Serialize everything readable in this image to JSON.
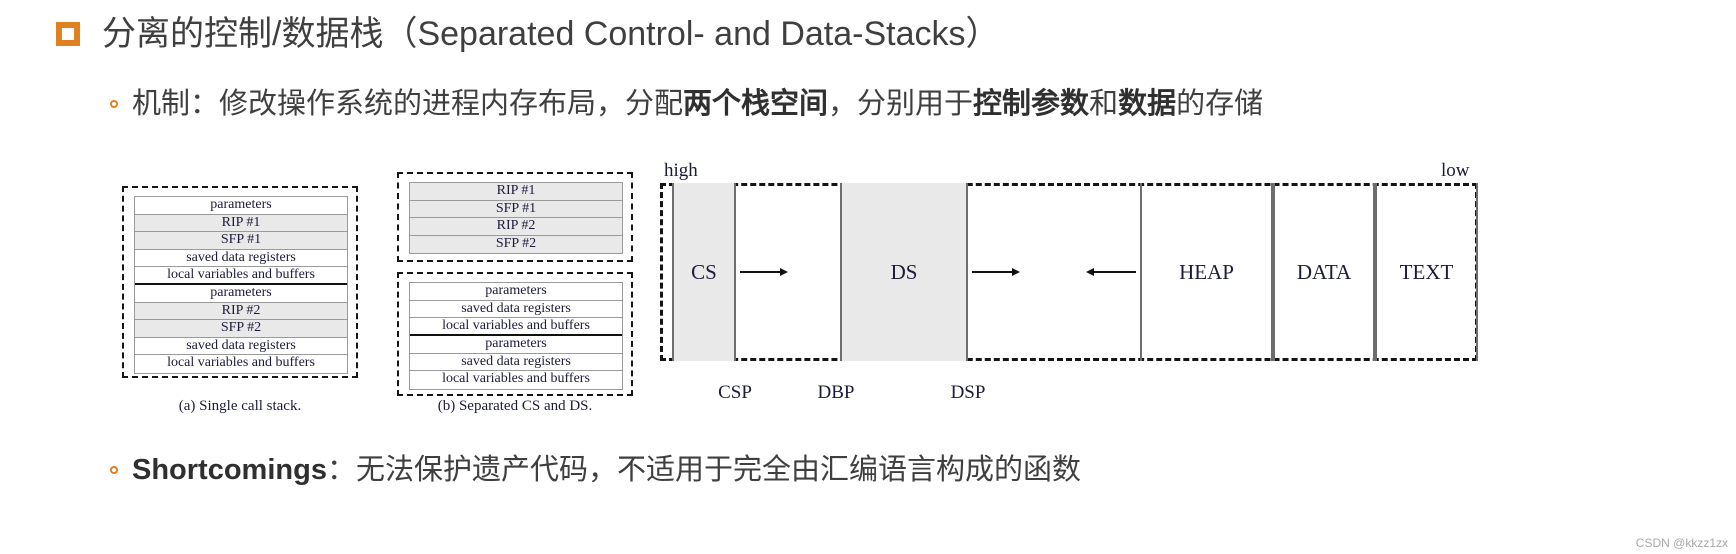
{
  "slide": {
    "title": "分离的控制/数据栈（Separated Control- and Data-Stacks）",
    "bullet_icon": "square-bullet-icon",
    "accent_color": "#e08020",
    "sub_bullet_icon": "circle-bullet-icon",
    "mechanism_line": {
      "prefix": "机制：修改操作系统的进程内存布局，分配",
      "bold1": "两个栈空间",
      "middle": "，分别用于",
      "bold2": "控制参数",
      "middle2": "和",
      "bold3": "数据",
      "suffix": "的存储",
      "full": "机制：修改操作系统的进程内存布局，分配两个栈空间，分别用于控制参数和数据的存储"
    },
    "shortcomings_line": {
      "label": "Shortcomings",
      "separator": "：",
      "text": "无法保护遗产代码，不适用于完全由汇编语言构成的函数",
      "full": "Shortcomings：无法保护遗产代码，不适用于完全由汇编语言构成的函数"
    },
    "watermark": "CSDN @kkzz1zx"
  },
  "figures": {
    "single_call_stack": {
      "caption": "(a) Single call stack.",
      "rows": [
        {
          "label": "parameters",
          "shaded": false,
          "separator": "normal"
        },
        {
          "label": "RIP #1",
          "shaded": true,
          "separator": "normal"
        },
        {
          "label": "SFP #1",
          "shaded": true,
          "separator": "normal"
        },
        {
          "label": "saved data registers",
          "shaded": false,
          "separator": "normal"
        },
        {
          "label": "local variables and buffers",
          "shaded": false,
          "separator": "thick"
        },
        {
          "label": "parameters",
          "shaded": false,
          "separator": "normal"
        },
        {
          "label": "RIP #2",
          "shaded": true,
          "separator": "normal"
        },
        {
          "label": "SFP #2",
          "shaded": true,
          "separator": "normal"
        },
        {
          "label": "saved data registers",
          "shaded": false,
          "separator": "normal"
        },
        {
          "label": "local variables and buffers",
          "shaded": false,
          "separator": "none"
        }
      ]
    },
    "separated_stacks": {
      "caption": "(b) Separated CS and DS.",
      "control_stack_rows": [
        {
          "label": "RIP #1",
          "shaded": true
        },
        {
          "label": "SFP #1",
          "shaded": true
        },
        {
          "label": "RIP #2",
          "shaded": true
        },
        {
          "label": "SFP #2",
          "shaded": true
        }
      ],
      "data_stack_rows": [
        {
          "label": "parameters",
          "shaded": false,
          "separator": "normal"
        },
        {
          "label": "saved data registers",
          "shaded": false,
          "separator": "normal"
        },
        {
          "label": "local variables and buffers",
          "shaded": false,
          "separator": "thick"
        },
        {
          "label": "parameters",
          "shaded": false,
          "separator": "normal"
        },
        {
          "label": "saved data registers",
          "shaded": false,
          "separator": "normal"
        },
        {
          "label": "local variables and buffers",
          "shaded": false,
          "separator": "none"
        }
      ]
    },
    "memory_layout": {
      "high_label": "high",
      "low_label": "low",
      "segments": [
        {
          "name": "CS",
          "filled": true
        },
        {
          "name": "DS",
          "filled": true
        },
        {
          "name": "HEAP",
          "filled": false
        },
        {
          "name": "DATA",
          "filled": false
        },
        {
          "name": "TEXT",
          "filled": false
        }
      ],
      "pointers": [
        {
          "name": "CSP"
        },
        {
          "name": "DBP"
        },
        {
          "name": "DSP"
        }
      ]
    }
  }
}
